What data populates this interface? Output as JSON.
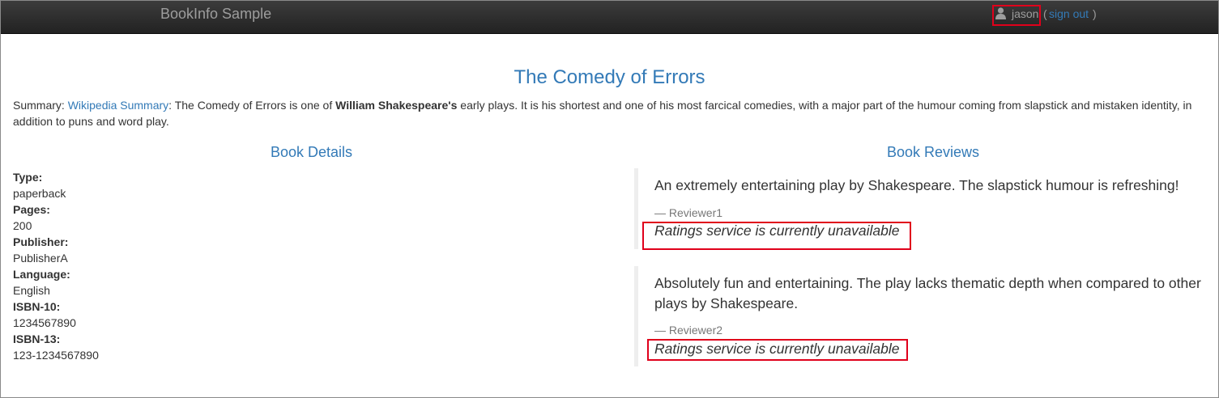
{
  "navbar": {
    "brand": "BookInfo Sample",
    "user": {
      "icon": "user-icon",
      "name": "jason",
      "open_paren": "(",
      "sign_out": "sign out",
      "close_paren": ")"
    }
  },
  "book": {
    "title": "The Comedy of Errors",
    "summary": {
      "label": "Summary:",
      "link": "Wikipedia Summary",
      "text_before_bold": ": The Comedy of Errors is one of ",
      "bold": "William Shakespeare's",
      "text_after_bold": " early plays. It is his shortest and one of his most farcical comedies, with a major part of the humour coming from slapstick and mistaken identity, in addition to puns and word play."
    }
  },
  "details": {
    "heading": "Book Details",
    "items": [
      {
        "label": "Type:",
        "value": "paperback"
      },
      {
        "label": "Pages:",
        "value": "200"
      },
      {
        "label": "Publisher:",
        "value": "PublisherA"
      },
      {
        "label": "Language:",
        "value": "English"
      },
      {
        "label": "ISBN-10:",
        "value": "1234567890"
      },
      {
        "label": "ISBN-13:",
        "value": "123-1234567890"
      }
    ]
  },
  "reviews": {
    "heading": "Book Reviews",
    "items": [
      {
        "text": "An extremely entertaining play by Shakespeare. The slapstick humour is refreshing!",
        "reviewer": "— Reviewer1",
        "rating": "Ratings service is currently unavailable"
      },
      {
        "text": "Absolutely fun and entertaining. The play lacks thematic depth when compared to other plays by Shakespeare.",
        "reviewer": "— Reviewer2",
        "rating": "Ratings service is currently unavailable"
      }
    ]
  },
  "colors": {
    "link": "#337ab7",
    "navbar": "#222222",
    "highlight_box": "#e0001b",
    "muted": "#777777"
  }
}
